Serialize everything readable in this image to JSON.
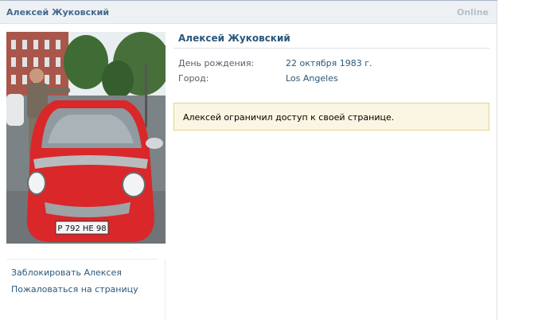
{
  "header": {
    "name": "Алексей Жуковский",
    "status": "Online"
  },
  "photo": {
    "plate": "Р 792 НЕ 98"
  },
  "actions": [
    {
      "label": "Заблокировать Алексея"
    },
    {
      "label": "Пожаловаться на страницу"
    }
  ],
  "profile": {
    "name": "Алексей Жуковский",
    "info": [
      {
        "label": "День рождения:",
        "value": "22 октября 1983 г."
      },
      {
        "label": "Город:",
        "value": "Los Angeles"
      }
    ]
  },
  "notice": {
    "text": "Алексей ограничил доступ к своей странице."
  },
  "colors": {
    "link": "#2b587a",
    "header_bg": "#eef1f4",
    "notice_bg": "#fbf6e3",
    "notice_border": "#e3d38f"
  }
}
